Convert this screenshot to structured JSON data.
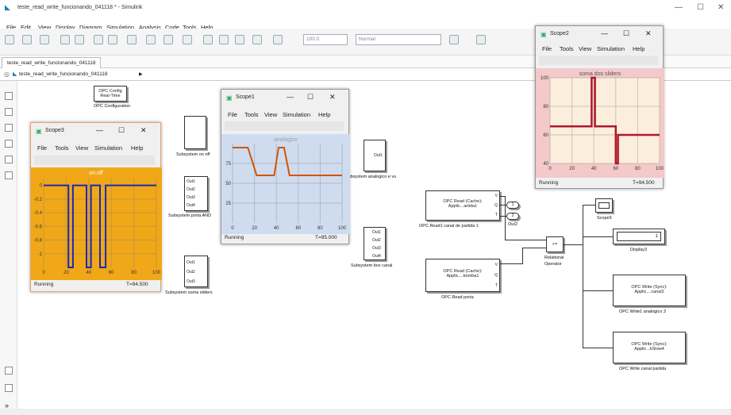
{
  "window": {
    "title": "teste_read_write_funcionando_041118 * - Simulink",
    "minimize_glyph": "—",
    "maximize_glyph": "☐",
    "close_glyph": "✕",
    "app_icon": "simulink-icon"
  },
  "menu": [
    "File",
    "Edit",
    "View",
    "Display",
    "Diagram",
    "Simulation",
    "Analysis",
    "Code",
    "Tools",
    "Help"
  ],
  "toolbar": {
    "stop_time": "100.0",
    "mode": "Normal"
  },
  "tab": "teste_read_write_funcionando_041118",
  "breadcrumb": {
    "model": "teste_read_write_funcionando_041118",
    "arrow": "▶"
  },
  "blocks": {
    "opc_config": {
      "line1": "OPC Config",
      "line2": "Real-Time",
      "label": "OPC Configuration"
    },
    "subsystem_on_off": {
      "label": "Subsystem on off"
    },
    "subsystem_porta_and": {
      "ports": [
        "Out1",
        "Out2",
        "Out3",
        "Out4"
      ],
      "label": "Subsystem porta AND"
    },
    "subsystem_soma": {
      "ports": [
        "Out1",
        "Out2",
        "Out3"
      ],
      "label": "Subsystem soma sliders"
    },
    "subsystem_analogico": {
      "ports": [
        "Out1"
      ],
      "label": "Subsystem analogico e vu"
    },
    "subsystem_boce": {
      "ports": [
        "Out1",
        "Out2",
        "Out3",
        "Out4"
      ],
      "label": "Subsystem bce canal"
    },
    "opc_read1": {
      "line1": "OPC Read (Cache):",
      "line2": "Applic...artida1",
      "ports": [
        "V",
        "Q",
        "T"
      ],
      "label": "OPC Read1 canal de partida 1"
    },
    "opc_read_porta": {
      "line1": "OPC Read (Cache):",
      "line2": "Applic....bomba1",
      "ports": [
        "V",
        "Q",
        "T"
      ],
      "label": "OPC Read porta"
    },
    "out1": {
      "num": "1"
    },
    "out2": {
      "num": "2",
      "label": "Out2"
    },
    "relational": {
      "op": ">=",
      "label1": "Relational",
      "label2": "Operator"
    },
    "scope5": {
      "label": "Scope5"
    },
    "display3": {
      "value": "1",
      "label": "Display3"
    },
    "opc_write1": {
      "line1": "OPC Write (Sync):",
      "line2": "Applic....canal2",
      "label": "OPC Write1 analogico 3"
    },
    "opc_write2": {
      "line1": "OPC Write (Sync):",
      "line2": "Applic...kStow4",
      "label": "OPC Write canal partida"
    }
  },
  "scope_menu": [
    "File",
    "Tools",
    "View",
    "Simulation",
    "Help"
  ],
  "scopes": {
    "scope1": {
      "title": "Scope1",
      "plot_title": "analogico",
      "status": "Running",
      "time": "T=95.000",
      "bg": "#cfdcef"
    },
    "scope2": {
      "title": "Scope2",
      "plot_title": "soma dos sliders",
      "status": "Running",
      "time": "T=94.500",
      "bg": "#fbeedc"
    },
    "scope3": {
      "title": "Scope3",
      "plot_title": "on off",
      "status": "Running",
      "time": "T=94.500",
      "bg": "#f0a818"
    }
  },
  "chart_data": [
    {
      "type": "line",
      "title": "analogico",
      "x": [
        0,
        14,
        22,
        25,
        28,
        38,
        42,
        47,
        52,
        58,
        100
      ],
      "values": [
        95,
        95,
        60,
        60,
        60,
        60,
        95,
        95,
        60,
        60,
        60
      ],
      "xlim": [
        0,
        100
      ],
      "xticks": [
        0,
        20,
        40,
        60,
        80,
        100
      ],
      "yticks": [
        75,
        50,
        25
      ],
      "ylim": [
        0,
        100
      ],
      "color": "#d35400",
      "grid": true
    },
    {
      "type": "line",
      "title": "soma dos sliders",
      "x": [
        0,
        38,
        38,
        41,
        41,
        60,
        60,
        62,
        62,
        75,
        100
      ],
      "values": [
        66,
        66,
        100,
        100,
        66,
        66,
        40,
        40,
        60,
        60,
        60
      ],
      "xlim": [
        0,
        100
      ],
      "ylim": [
        40,
        100
      ],
      "xticks": [
        0,
        20,
        40,
        60,
        80,
        100
      ],
      "yticks": [
        100,
        80,
        60,
        40
      ],
      "color": "#b0182a",
      "grid": true
    },
    {
      "type": "line",
      "title": "on off",
      "x": [
        0,
        22,
        22,
        26,
        26,
        38,
        38,
        42,
        42,
        50,
        50,
        55,
        55,
        100
      ],
      "values": [
        0,
        0,
        -1.2,
        -1.2,
        0,
        0,
        -1.2,
        -1.2,
        0,
        0,
        -1.2,
        -1.2,
        0,
        0
      ],
      "xlim": [
        0,
        100
      ],
      "ylim": [
        -1.2,
        0.1
      ],
      "xticks": [
        0,
        20,
        40,
        60,
        80,
        100
      ],
      "yticks": [
        0,
        -0.2,
        -0.4,
        -0.6,
        -0.8,
        -1
      ],
      "color": "#1b28b5",
      "grid": true
    }
  ]
}
